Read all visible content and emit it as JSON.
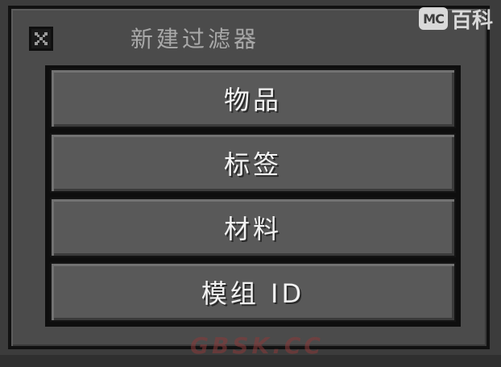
{
  "dialog": {
    "title": "新建过滤器",
    "close_icon": "close-x-icon",
    "options": [
      {
        "label": "物品"
      },
      {
        "label": "标签"
      },
      {
        "label": "材料"
      },
      {
        "label": "模组 ID"
      }
    ]
  },
  "watermarks": {
    "top_logo_text": "MC",
    "top_text": "百科",
    "bottom_text": "GBSK.CC"
  },
  "colors": {
    "panel": "#4b4b4b",
    "button": "#595959",
    "button_text": "#f2f2f2",
    "title_text": "#a9a9a9"
  }
}
